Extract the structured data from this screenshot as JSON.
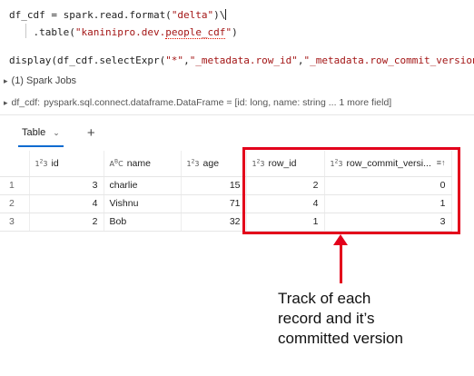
{
  "code": {
    "line1_prefix": "df_cdf = spark.read.format(",
    "line1_str": "\"delta\"",
    "line1_suffix": ")\\",
    "line2_prefix": "    .table(",
    "line2_str_a": "\"kaninipro.dev.",
    "line2_str_b": "people_cdf",
    "line2_str_c": "\"",
    "line2_suffix": ")",
    "line3_prefix": "display(df_cdf.selectExpr(",
    "line3_str1": "\"*\"",
    "line3_comma1": ",",
    "line3_str2": "\"_metadata.row_id\"",
    "line3_comma2": ",",
    "line3_str3": "\"_metadata.row_commit_version\"",
    "line3_suffix": "))"
  },
  "output": {
    "spark_jobs": "(1) Spark Jobs",
    "df_name": "df_cdf:",
    "df_type": "pyspark.sql.connect.dataframe.DataFrame = [id: long, name: string ... 1 more field]"
  },
  "tabs": {
    "table_label": "Table",
    "add_label": "+"
  },
  "table": {
    "columns": [
      {
        "type": "1²3",
        "label": "id"
      },
      {
        "type": "A^B_C",
        "label": "name"
      },
      {
        "type": "1²3",
        "label": "age"
      },
      {
        "type": "1²3",
        "label": "row_id"
      },
      {
        "type": "1²3",
        "label": "row_commit_versi..."
      }
    ],
    "rows": [
      {
        "n": "1",
        "id": "3",
        "name": "charlie",
        "age": "15",
        "row_id": "2",
        "ver": "0"
      },
      {
        "n": "2",
        "id": "4",
        "name": "Vishnu",
        "age": "71",
        "row_id": "4",
        "ver": "1"
      },
      {
        "n": "3",
        "id": "2",
        "name": "Bob",
        "age": "32",
        "row_id": "1",
        "ver": "3"
      }
    ]
  },
  "annotation": {
    "text_line1": "Track of each",
    "text_line2": "record and it’s",
    "text_line3": "committed version"
  },
  "colors": {
    "highlight": "#e3001b",
    "string": "#a31515",
    "tab_underline": "#0e6bd0"
  }
}
